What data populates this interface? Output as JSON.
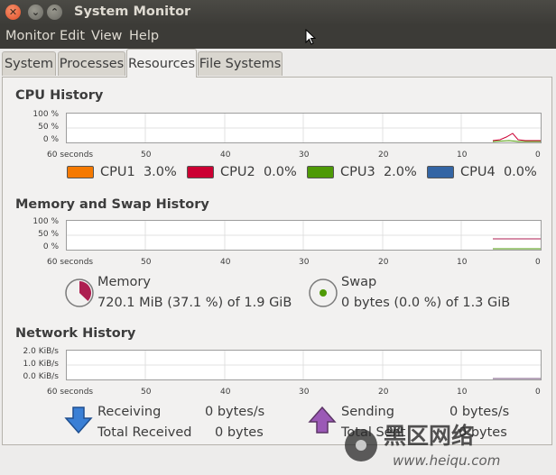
{
  "window": {
    "title": "System Monitor"
  },
  "menu": [
    "Monitor",
    "Edit",
    "View",
    "Help"
  ],
  "tabs": [
    "System",
    "Processes",
    "Resources",
    "File Systems"
  ],
  "active_tab": "Resources",
  "x_axis_labels": [
    "60 seconds",
    "50",
    "40",
    "30",
    "20",
    "10",
    "0"
  ],
  "cpu": {
    "title": "CPU History",
    "y_labels": [
      "100 %",
      "50 %",
      "0 %"
    ],
    "legend": [
      {
        "label": "CPU1",
        "value": "3.0%",
        "color": "#f57900"
      },
      {
        "label": "CPU2",
        "value": "0.0%",
        "color": "#cc0033"
      },
      {
        "label": "CPU3",
        "value": "2.0%",
        "color": "#4e9a06"
      },
      {
        "label": "CPU4",
        "value": "0.0%",
        "color": "#3465a4"
      }
    ]
  },
  "memory": {
    "title": "Memory and Swap History",
    "y_labels": [
      "100 %",
      "50 %",
      "0 %"
    ],
    "memory_label": "Memory",
    "memory_value": "720.1 MiB (37.1 %) of 1.9 GiB",
    "memory_fraction": 0.371,
    "memory_color": "#ad1e50",
    "swap_label": "Swap",
    "swap_value": "0 bytes (0.0 %) of 1.3 GiB",
    "swap_color": "#4e9a06"
  },
  "network": {
    "title": "Network History",
    "y_labels": [
      "2.0 KiB/s",
      "1.0 KiB/s",
      "0.0 KiB/s"
    ],
    "receiving_label": "Receiving",
    "receiving_value": "0 bytes/s",
    "total_received_label": "Total Received",
    "total_received_value": "0 bytes",
    "sending_label": "Sending",
    "sending_value": "0 bytes/s",
    "total_sent_label": "Total Sent",
    "total_sent_value": "0 bytes"
  },
  "watermark": {
    "text_cn": "黑区网络",
    "text_url": "www.heiqu.com"
  }
}
